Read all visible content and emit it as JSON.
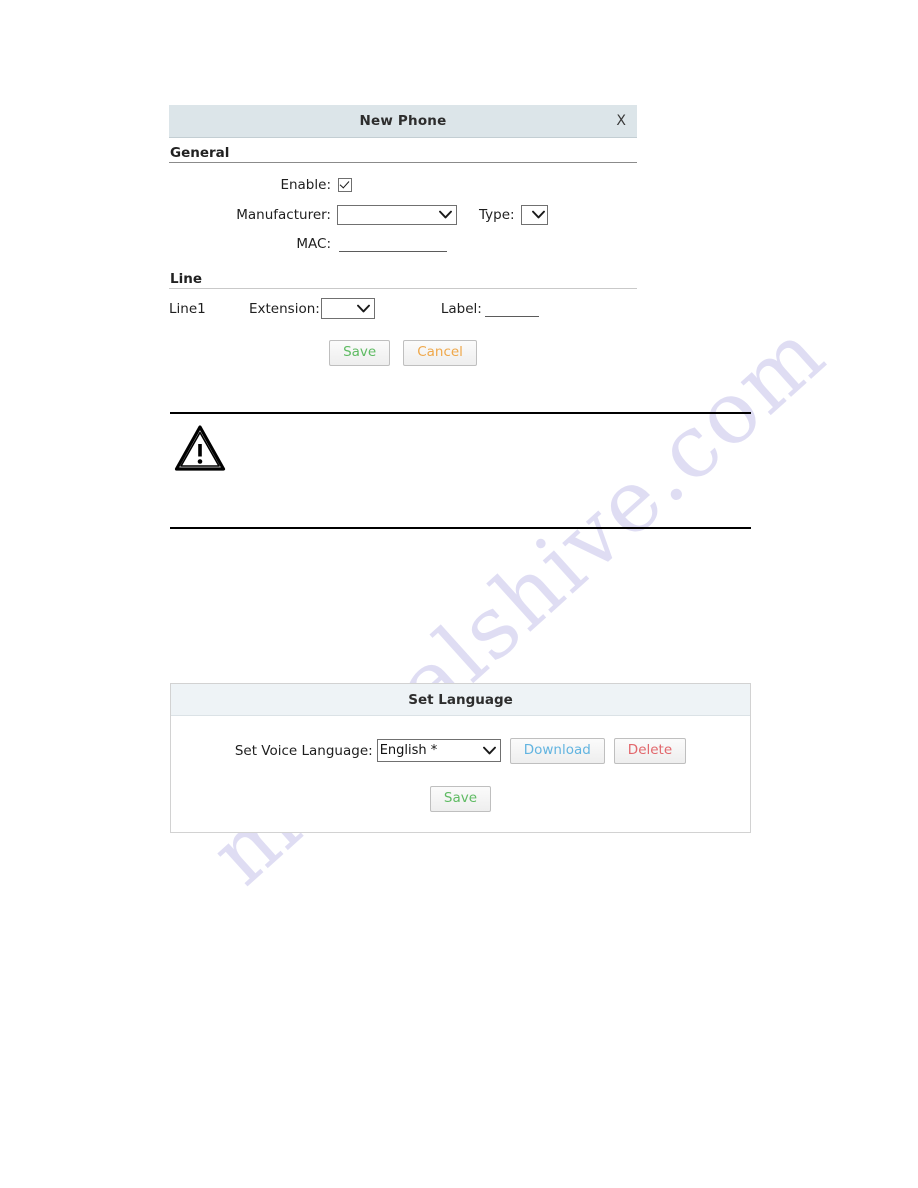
{
  "watermark": {
    "text": "manualshive.com"
  },
  "new_phone_dialog": {
    "title": "New Phone",
    "close_label": "X",
    "sections": {
      "general": {
        "heading": "General",
        "enable": {
          "label": "Enable:",
          "checked": true,
          "icon": "checkbox-checked-icon"
        },
        "manufacturer": {
          "label": "Manufacturer:",
          "value": "",
          "options": [
            ""
          ]
        },
        "type": {
          "label": "Type:",
          "value": "",
          "options": [
            ""
          ]
        },
        "mac": {
          "label": "MAC:",
          "value": "",
          "placeholder": ""
        }
      },
      "line": {
        "heading": "Line",
        "rows": [
          {
            "name": "Line1",
            "extension": {
              "label": "Extension:",
              "value": "",
              "options": [
                ""
              ]
            },
            "label_field": {
              "label": "Label:",
              "value": "",
              "placeholder": ""
            }
          }
        ]
      }
    },
    "buttons": {
      "save": "Save",
      "cancel": "Cancel"
    }
  },
  "note_block": {
    "icon": "warning-triangle-icon",
    "text": ""
  },
  "set_language_panel": {
    "title": "Set Language",
    "voice_language": {
      "label": "Set Voice Language:",
      "value": "English *",
      "options": [
        "English *"
      ]
    },
    "buttons": {
      "download": "Download",
      "delete": "Delete",
      "save": "Save"
    }
  },
  "colors": {
    "dialog_header": "#dce5e9",
    "panel_header": "#eef3f6",
    "save_text": "#5fbb63",
    "cancel_text": "#efa84b",
    "download_text": "#62b4e0",
    "delete_text": "#e2676c",
    "watermark": "#b9b6e6"
  }
}
